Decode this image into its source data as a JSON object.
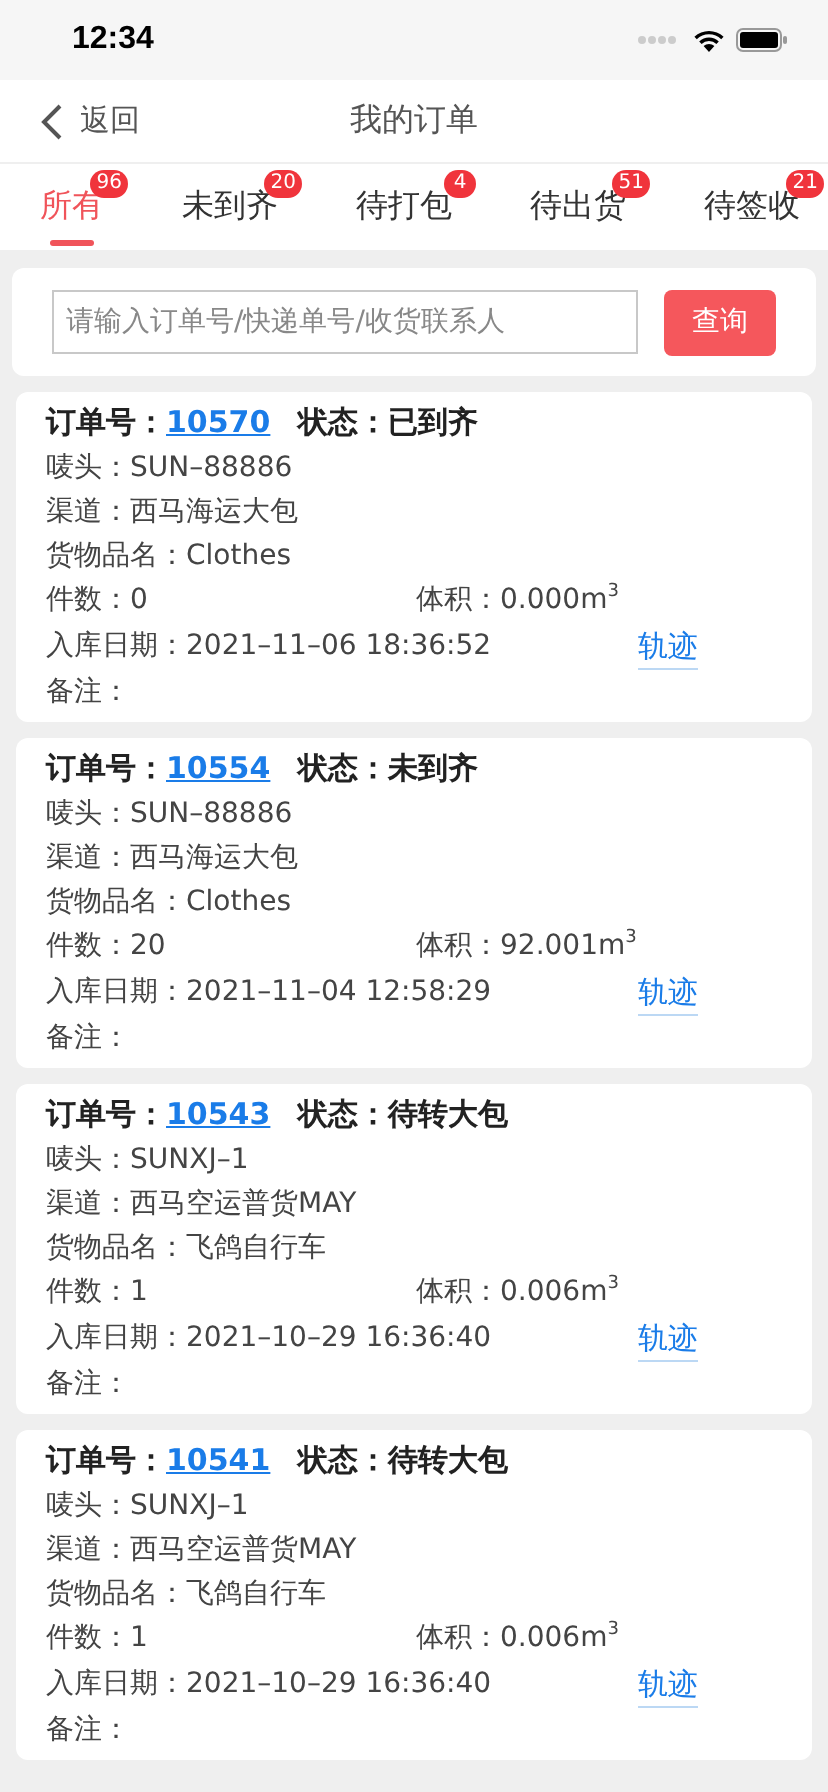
{
  "status_bar": {
    "time": "12:34"
  },
  "nav": {
    "back": "返回",
    "title": "我的订单"
  },
  "tabs": [
    {
      "label": "所有",
      "badge": "96",
      "selected": true
    },
    {
      "label": "未到齐",
      "badge": "20",
      "selected": false
    },
    {
      "label": "待打包",
      "badge": "4",
      "selected": false
    },
    {
      "label": "待出货",
      "badge": "51",
      "selected": false
    },
    {
      "label": "待签收",
      "badge": "21",
      "selected": false
    }
  ],
  "search": {
    "placeholder": "请输入订单号/快递单号/收货联系人",
    "button": "查询"
  },
  "orders": [
    {
      "order_label": "订单号：",
      "order_no": "10570",
      "status_label": "状态：",
      "status": "已到齐",
      "mark": "唛头：SUN–88886",
      "channel": "渠道：西马海运大包",
      "goods": "货物品名：Clothes",
      "count": "件数：0",
      "volume": "体积：0.000m$^{3}$",
      "date": "入库日期：2021–11–06 18:36:52",
      "track": "轨迹",
      "note": "备注："
    },
    {
      "order_label": "订单号：",
      "order_no": "10554",
      "status_label": "状态：",
      "status": "未到齐",
      "mark": "唛头：SUN–88886",
      "channel": "渠道：西马海运大包",
      "goods": "货物品名：Clothes",
      "count": "件数：20",
      "volume": "体积：92.001m$^{3}$",
      "date": "入库日期：2021–11–04 12:58:29",
      "track": "轨迹",
      "note": "备注："
    },
    {
      "order_label": "订单号：",
      "order_no": "10543",
      "status_label": "状态：",
      "status": "待转大包",
      "mark": "唛头：SUNXJ–1",
      "channel": "渠道：西马空运普货MAY",
      "goods": "货物品名：飞鸽自行车",
      "count": "件数：1",
      "volume": "体积：0.006m$^{3}$",
      "date": "入库日期：2021–10–29 16:36:40",
      "track": "轨迹",
      "note": "备注："
    },
    {
      "order_label": "订单号：",
      "order_no": "10541",
      "status_label": "状态：",
      "status": "待转大包",
      "mark": "唛头：SUNXJ–1",
      "channel": "渠道：西马空运普货MAY",
      "goods": "货物品名：飞鸽自行车",
      "count": "件数：1",
      "volume": "体积：0.006m$^{3}$",
      "date": "入库日期：2021–10–29 16:36:40",
      "track": "轨迹",
      "note": "备注："
    }
  ]
}
